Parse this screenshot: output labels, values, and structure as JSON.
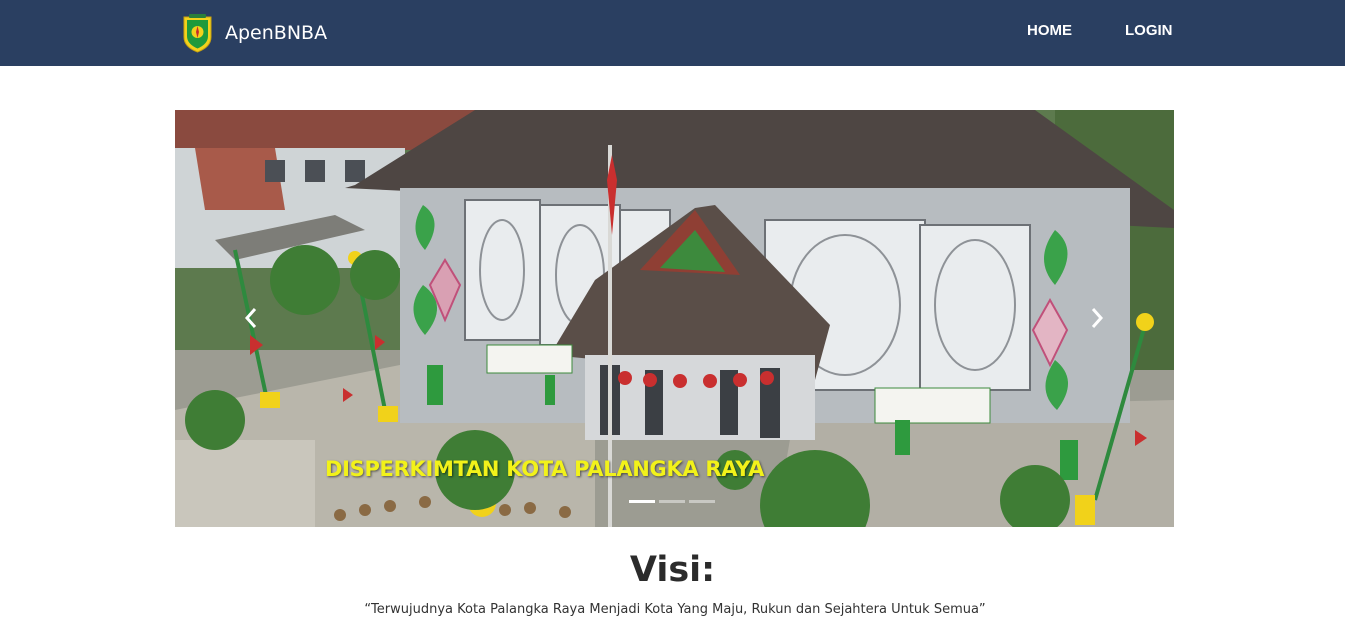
{
  "navbar": {
    "brand_name": "ApenBNBA",
    "brand_icon": "city-emblem-icon",
    "links": [
      {
        "label": "HOME"
      },
      {
        "label": "LOGIN"
      }
    ],
    "background_color": "#2a3f61"
  },
  "carousel": {
    "caption": "DISPERKIMTAN KOTA PALANGKA RAYA",
    "caption_color": "#f2f21a",
    "prev_icon": "chevron-left-icon",
    "next_icon": "chevron-right-icon",
    "slide_count": 3,
    "active_slide": 1
  },
  "visi": {
    "title": "Visi:",
    "text": "“Terwujudnya Kota Palangka Raya Menjadi Kota Yang Maju, Rukun dan Sejahtera Untuk Semua”"
  }
}
